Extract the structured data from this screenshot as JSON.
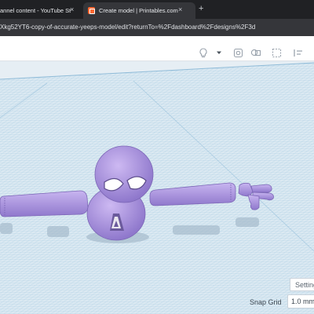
{
  "browser": {
    "tabs": [
      {
        "title": "annel content - YouTube St",
        "active": false
      },
      {
        "title": "Create model | Printables.com",
        "active": true
      }
    ],
    "tab_close_symbol": "×",
    "new_tab_symbol": "+",
    "url": "Xkg52YT6-copy-of-accurate-yeeps-model/edit?returnTo=%2Fdashboard%2Fdesigns%2F3d"
  },
  "toolbar": {
    "icons": [
      "lightbulb-icon",
      "dropdown-caret-icon",
      "shape-mirror-icon",
      "group-icon",
      "ungroup-icon",
      "align-icon"
    ]
  },
  "workplane": {
    "settings_label": "Settings",
    "snap_grid_label": "Snap Grid",
    "snap_grid_value": "1.0 mm"
  },
  "colors": {
    "model": "#b59ee8",
    "model_dark": "#8f78cc",
    "grid_line": "#a8cde3",
    "grid_major": "#8fbbd8",
    "chrome_dark": "#202124",
    "chrome_mid": "#35363a"
  }
}
